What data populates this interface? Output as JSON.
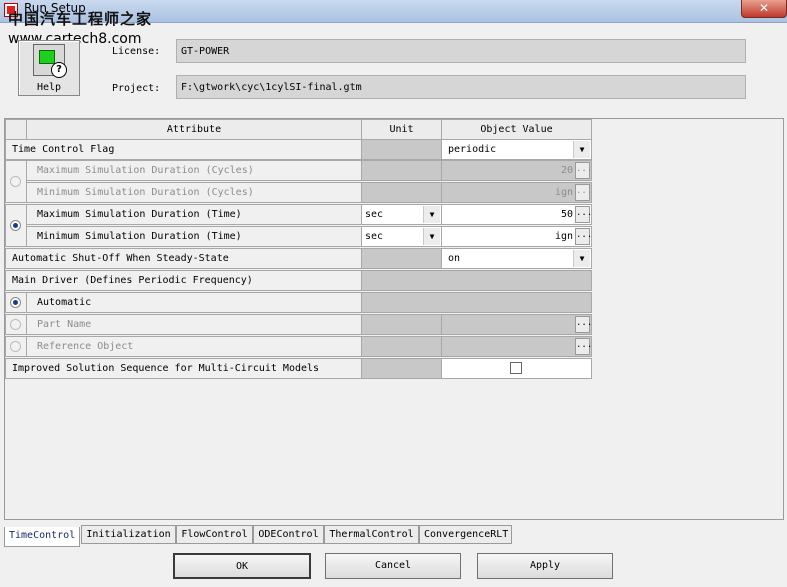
{
  "window": {
    "title": "Run Setup",
    "watermark_cn": "中国汽车工程师之家",
    "watermark_url": "www.cartech8.com",
    "close_glyph": "✕"
  },
  "header": {
    "help_label": "Help",
    "license_label": "License:",
    "license_value": "GT-POWER",
    "project_label": "Project:",
    "project_value": "F:\\gtwork\\cyc\\1cylSI-final.gtm"
  },
  "table": {
    "columns": {
      "attribute": "Attribute",
      "unit": "Unit",
      "value": "Object Value"
    },
    "rows": {
      "time_control_flag": {
        "attribute": "Time Control Flag",
        "value": "periodic"
      },
      "max_sim_cycles": {
        "attribute": "Maximum Simulation Duration (Cycles)",
        "value": "20"
      },
      "min_sim_cycles": {
        "attribute": "Minimum Simulation Duration (Cycles)",
        "value": "ign"
      },
      "max_sim_time": {
        "attribute": "Maximum Simulation Duration (Time)",
        "unit": "sec",
        "value": "50"
      },
      "min_sim_time": {
        "attribute": "Minimum Simulation Duration (Time)",
        "unit": "sec",
        "value": "ign"
      },
      "auto_shutoff": {
        "attribute": "Automatic Shut-Off When Steady-State",
        "value": "on"
      },
      "main_driver": {
        "attribute": "Main Driver (Defines Periodic Frequency)"
      },
      "automatic": {
        "attribute": "Automatic"
      },
      "part_name": {
        "attribute": "Part Name"
      },
      "reference_object": {
        "attribute": "Reference Object"
      },
      "improved_solution": {
        "attribute": "Improved Solution Sequence for Multi-Circuit Models"
      }
    },
    "dropdown_glyph": "▼",
    "dots_glyph": "..."
  },
  "tabs": [
    "TimeControl",
    "Initialization",
    "FlowControl",
    "ODEControl",
    "ThermalControl",
    "ConvergenceRLT"
  ],
  "buttons": {
    "ok": "OK",
    "cancel": "Cancel",
    "apply": "Apply"
  }
}
